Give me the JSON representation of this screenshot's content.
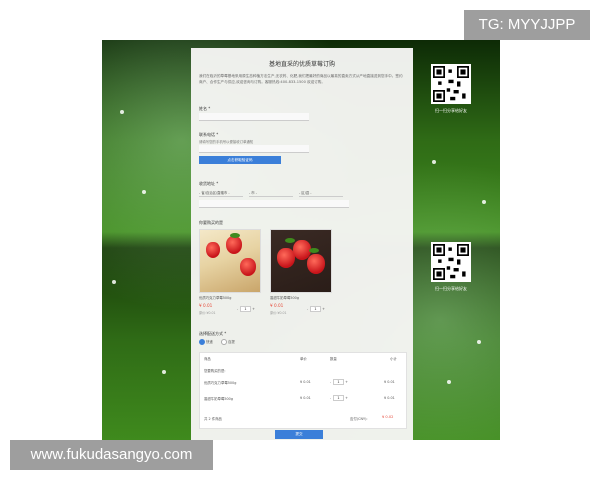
{
  "form": {
    "title": "基地直采的优质草莓订购",
    "intro": "我们在临沂的草莓基地采用原生态种植方法生产,无农药、化肥,我们把最好的商品以最真的直卖方式从产地直接送到您手中。签约商户、合作生产与供应,欢迎咨询与订购。客服热线:400-833-1500 欢迎订购。",
    "name_label": "姓名 *",
    "phone_label": "联系电话 *",
    "phone_hint": "请填写您的手机号以便接收订单通知",
    "verify_button": "点击获取验证码",
    "address_label": "收货地址 *",
    "province_placeholder": "- 省/自治区/直辖市 -",
    "city_placeholder": "- 市 -",
    "district_placeholder": "- 区/县 -",
    "products_label": "你要购买的是",
    "products": [
      {
        "name": "优质巧克力草莓500g",
        "price": "¥ 0.01",
        "old_price": "原价:¥0.01",
        "qty": "1"
      },
      {
        "name": "香甜牛奶草莓500g",
        "price": "¥ 0.01",
        "old_price": "原价:¥0.01",
        "qty": "1"
      }
    ],
    "delivery_label": "选择配送方式 *",
    "delivery_options": [
      "快递",
      "自提"
    ],
    "table_headers": [
      "商品",
      "单价",
      "数量",
      "小计"
    ],
    "table_section": "您要购买的是:",
    "table_rows": [
      {
        "name": "优质巧克力草莓500g",
        "price": "¥ 0.01",
        "qty": "1",
        "subtotal": "¥ 0.01"
      },
      {
        "name": "香甜牛奶草莓500g",
        "price": "¥ 0.01",
        "qty": "1",
        "subtotal": "¥ 0.01"
      }
    ],
    "total_count": "共 2 件商品",
    "total_label": "应付(CNY):",
    "total_value": "¥ 0.02",
    "submit_button": "提交"
  },
  "qr": {
    "caption": "扫一扫分享给好友"
  },
  "overlay": {
    "tag": "TG: MYYJJPP",
    "watermark": "www.fukudasangyo.com"
  },
  "colors": {
    "accent": "#3b7fd9",
    "price": "#e64a3a",
    "grass": "#3f8a1d"
  }
}
